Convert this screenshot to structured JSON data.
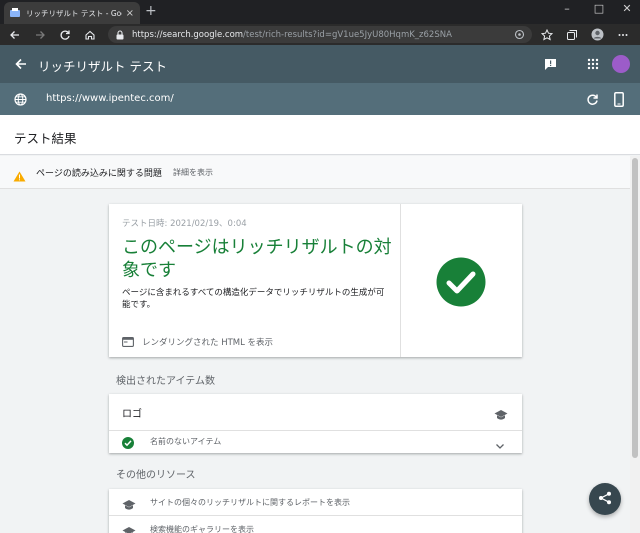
{
  "browser": {
    "tab_title": "リッチリザルト テスト - Google Search",
    "tab_close": "×",
    "new_tab": "+",
    "url_host": "https://search.google.com",
    "url_path": "/test/rich-results?id=gV1ue5JyU80HqmK_z62SNA",
    "icons": [
      "back-icon",
      "forward-icon",
      "reload-icon",
      "home-icon",
      "lock-icon",
      "star-icon",
      "collections-icon",
      "profile-icon",
      "more-icon"
    ]
  },
  "app": {
    "title": "リッチリザルト テスト",
    "tested_url": "https://www.ipentec.com/",
    "results_title": "テスト結果",
    "accent_color": "#188038",
    "header_color": "#455a64"
  },
  "issue": {
    "text": "ページの読み込みに関する問題",
    "link": "詳細を表示"
  },
  "verdict": {
    "test_date": "テスト日時: 2021/02/19、0:04",
    "title": "このページはリッチリザルトの対象です",
    "description": "ページに含まれるすべての構造化データでリッチリザルトの生成が可能です。",
    "render_link": "レンダリングされた HTML を表示"
  },
  "detected": {
    "heading": "検出されたアイテム数",
    "item_type": "ロゴ",
    "item_name": "名前のないアイテム"
  },
  "resources": {
    "heading": "その他のリソース",
    "items": [
      "サイトの個々のリッチリザルトに関するレポートを表示",
      "検索機能のギャラリーを表示"
    ]
  }
}
